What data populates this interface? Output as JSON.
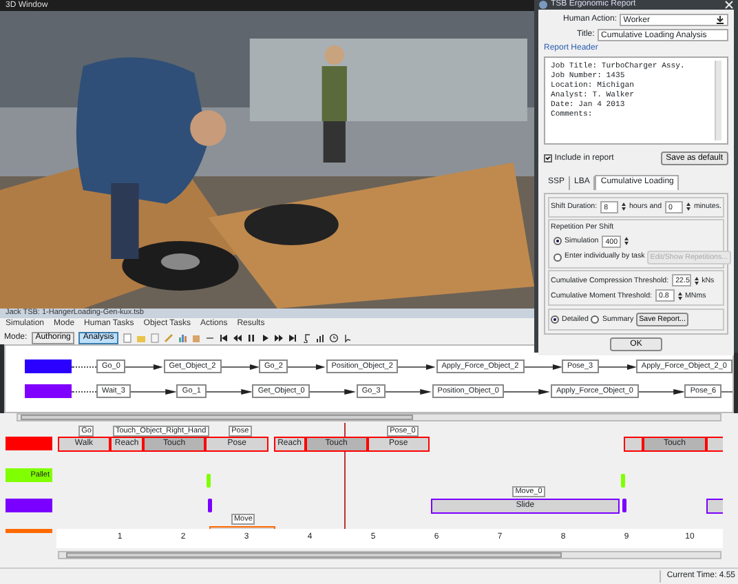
{
  "viewport": {
    "title": "3D Window"
  },
  "report_dialog": {
    "title": "TSB Ergonomic Report",
    "human_action": {
      "label": "Human Action:",
      "value": "Worker"
    },
    "title_field": {
      "label": "Title:",
      "value": "Cumulative Loading Analysis"
    },
    "report_header": {
      "label": "Report Header",
      "lines": [
        "Job Title: TurboCharger Assy.",
        "Job Number: 1435",
        "Location: Michigan",
        "Analyst: T. Walker",
        "Date: Jan 4 2013",
        "Comments:"
      ]
    },
    "include_in_report": {
      "label": "Include in report",
      "checked": true
    },
    "save_default": "Save as default",
    "tabs": [
      {
        "label": "SSP",
        "selected": false
      },
      {
        "label": "LBA",
        "selected": false
      },
      {
        "label": "Cumulative Loading",
        "selected": true
      }
    ],
    "shift": {
      "label": "Shift Duration:",
      "hours": "8",
      "hours_unit": "hours and",
      "minutes": "0",
      "minutes_unit": "minutes."
    },
    "repetition": {
      "title": "Repetition Per Shift",
      "options": [
        {
          "label": "Simulation",
          "selected": true,
          "value": "400"
        },
        {
          "label": "Enter individually by task",
          "selected": false,
          "button": "Edit/Show Repetitions...",
          "button_disabled": true
        }
      ]
    },
    "thresholds": [
      {
        "label": "Cumulative Compression Threshold:",
        "value": "22.5",
        "unit": "kNs"
      },
      {
        "label": "Cumulative Moment Threshold:",
        "value": "0.8",
        "unit": "MNms"
      }
    ],
    "report_type": [
      {
        "label": "Detailed",
        "selected": true
      },
      {
        "label": "Summary",
        "selected": false
      }
    ],
    "save_report": "Save Report...",
    "ok": "OK"
  },
  "app": {
    "title": "Jack TSB: 1-HangerLoading-Gen-kux.tsb",
    "menu": [
      "Simulation",
      "Mode",
      "Human Tasks",
      "Object Tasks",
      "Actions",
      "Results"
    ],
    "mode": {
      "label": "Mode:",
      "options": [
        {
          "label": "Authoring",
          "selected": false
        },
        {
          "label": "Analysis",
          "selected": true
        }
      ]
    }
  },
  "flow": {
    "lanes": [
      {
        "color": "#2b00ff",
        "steps": [
          "Go_0",
          "Get_Object_2",
          "Go_2",
          "Position_Object_2",
          "Apply_Force_Object_2",
          "Pose_3",
          "Apply_Force_Object_2_0"
        ]
      },
      {
        "color": "#8000ff",
        "steps": [
          "Wait_3",
          "Go_1",
          "Get_Object_0",
          "Go_3",
          "Position_Object_0",
          "Apply_Force_Object_0",
          "Pose_6"
        ]
      }
    ]
  },
  "timeline": {
    "lanes": [
      {
        "color": "#ff0000",
        "tags": [
          "Go",
          "Touch_Object_Right_Hand",
          "Pose",
          "Pose_0"
        ],
        "segments": [
          {
            "label": "Walk",
            "shaded": false
          },
          {
            "label": "Reach",
            "shaded": false
          },
          {
            "label": "Touch",
            "shaded": true
          },
          {
            "label": "Pose",
            "shaded": false
          },
          {
            "label": "Reach",
            "shaded": false
          },
          {
            "label": "Touch",
            "shaded": true
          },
          {
            "label": "Pose",
            "shaded": false
          },
          {
            "shaded": false
          },
          {
            "label": "Touch",
            "shaded": true
          },
          {
            "shaded": false
          }
        ]
      },
      {
        "color": "#80ff00",
        "label": "Pallet",
        "segments": [
          {
            "kind": "tick"
          },
          {
            "kind": "tick"
          }
        ]
      },
      {
        "color": "#7a00ff",
        "tags": [
          "Move_0"
        ],
        "segments": [
          {
            "kind": "tick"
          },
          {
            "label": "Slide",
            "shaded": false
          },
          {
            "kind": "tick"
          },
          {
            "shaded": false
          }
        ]
      },
      {
        "color": "#ff6a00",
        "tags": [
          "Move"
        ],
        "segments": [
          {
            "shaded": false
          }
        ]
      }
    ],
    "ticks": [
      "1",
      "2",
      "3",
      "4",
      "5",
      "6",
      "7",
      "8",
      "9",
      "10"
    ]
  },
  "status_bar": {
    "label": "Current Time:",
    "value": "4.55"
  }
}
